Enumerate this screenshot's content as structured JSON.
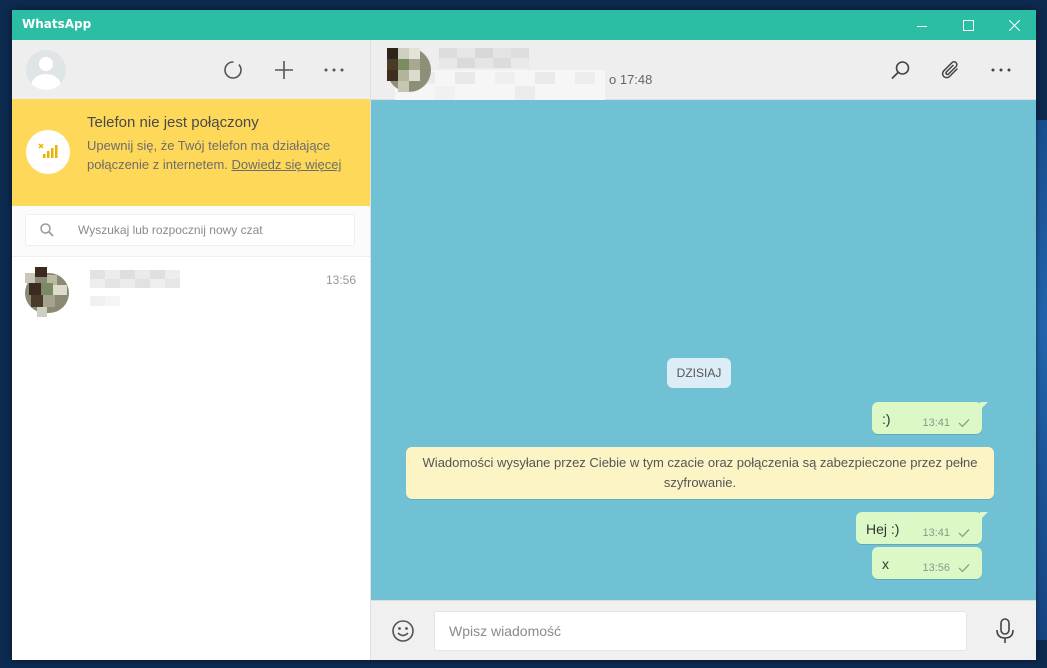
{
  "window": {
    "title": "WhatsApp",
    "controls": [
      "minimize",
      "maximize",
      "close"
    ]
  },
  "sidebar": {
    "header_icons": [
      "status-icon",
      "new-chat-icon",
      "menu-icon"
    ],
    "alert": {
      "title": "Telefon nie jest połączony",
      "text": "Upewnij się, że Twój telefon ma działające połączenie z internetem.",
      "link": "Dowiedz się więcej",
      "icon": "phone-signal-icon"
    },
    "search": {
      "placeholder": "Wyszukaj lub rozpocznij nowy czat"
    },
    "chats": [
      {
        "time": "13:56"
      }
    ]
  },
  "chat": {
    "last_seen": "o 17:48",
    "header_icons": [
      "search-icon",
      "attach-icon",
      "menu-icon"
    ],
    "day_label": "DZISIAJ",
    "messages": [
      {
        "text": ":)",
        "time": "13:41",
        "status": "sent"
      },
      {
        "text": "Hej :)",
        "time": "13:41",
        "status": "sent"
      },
      {
        "text": "x",
        "time": "13:56",
        "status": "sent"
      }
    ],
    "encryption_notice": "Wiadomości wysyłane przez Ciebie w tym czacie oraz połączenia są zabezpieczone przez pełne szyfrowanie.",
    "composer": {
      "placeholder": "Wpisz wiadomość"
    }
  },
  "colors": {
    "titlebar": "#2bbea4",
    "alert_bg": "#fed859",
    "chat_bg": "#6fc1d3",
    "bubble_out": "#dcf8c6",
    "system_notice": "#fcf4c4"
  }
}
